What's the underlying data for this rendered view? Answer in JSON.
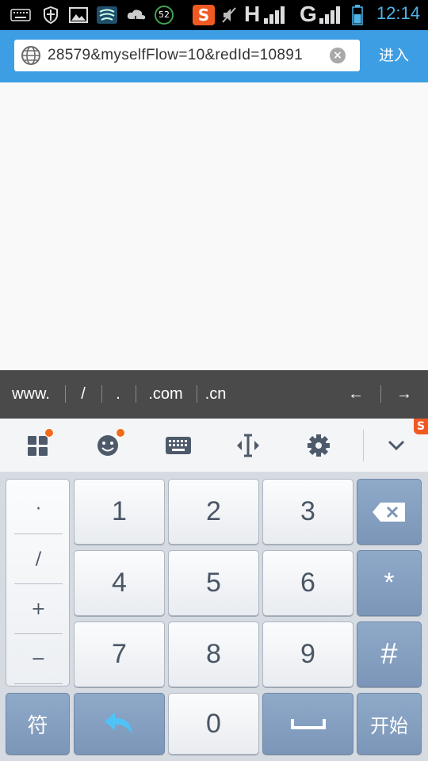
{
  "status_bar": {
    "time": "12:14",
    "battery_badge": "52",
    "network_1": "H",
    "network_2": "G",
    "icons": [
      "keyboard-icon",
      "shield-icon",
      "image-icon",
      "weather-icon",
      "cloud-icon",
      "battery-badge-icon",
      "sogou-icon",
      "mute-icon",
      "signal-icon",
      "signal-icon",
      "battery-icon"
    ]
  },
  "url_bar": {
    "url": "28579&myselfFlow=10&redId=10891",
    "enter_label": "进入"
  },
  "quick_bar": {
    "items": [
      "www.",
      "/",
      ".",
      ".com",
      ".cn"
    ],
    "back_arrow": "←",
    "forward_arrow": "→"
  },
  "ime_toolbar": {
    "icons": [
      "apps-icon",
      "emoji-icon",
      "keyboard-icon",
      "cursor-move-icon",
      "settings-icon",
      "collapse-icon"
    ],
    "badge_color": "#f26a1b"
  },
  "keyboard": {
    "symbols": [
      "·",
      "/",
      "+",
      "−"
    ],
    "digits": [
      "1",
      "2",
      "3",
      "4",
      "5",
      "6",
      "7",
      "8",
      "9"
    ],
    "zero": "0",
    "star": "*",
    "hash": "#",
    "symbol_key": "符",
    "go_key": "开始"
  },
  "colors": {
    "accent": "#3d9ee4",
    "key_dark": "#7b96b8"
  }
}
